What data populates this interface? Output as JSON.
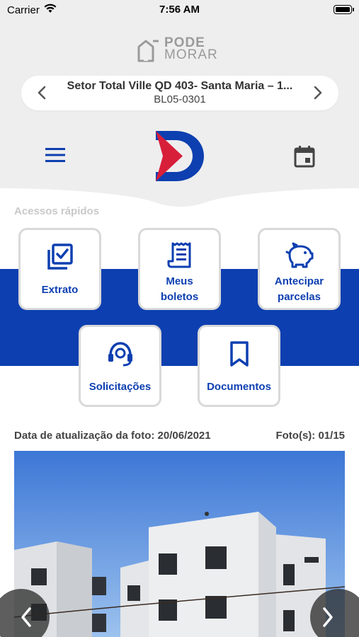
{
  "status_bar": {
    "carrier": "Carrier",
    "time": "7:56 AM"
  },
  "brand": {
    "line1": "PODE",
    "line2": "MORAR"
  },
  "selector": {
    "title": "Setor Total Ville QD 403- Santa Maria – 1...",
    "unit": "BL05-0301"
  },
  "quick_access": {
    "label": "Acessos rápidos",
    "items": [
      {
        "line1": "Extrato",
        "line2": "",
        "icon": "checklist-icon"
      },
      {
        "line1": "Meus",
        "line2": "boletos",
        "icon": "receipt-icon"
      },
      {
        "line1": "Antecipar",
        "line2": "parcelas",
        "icon": "piggy-bank-icon"
      },
      {
        "line1": "Solicitações",
        "line2": "",
        "icon": "headset-icon"
      },
      {
        "line1": "Documentos",
        "line2": "",
        "icon": "bookmark-icon"
      }
    ]
  },
  "photo": {
    "date_text": "Data de atualização da foto: 20/06/2021",
    "count_text": "Foto(s): 01/15"
  },
  "colors": {
    "primary_blue": "#0d3fb0",
    "accent_red": "#d81f3a",
    "header_gray": "#eeeeee"
  }
}
